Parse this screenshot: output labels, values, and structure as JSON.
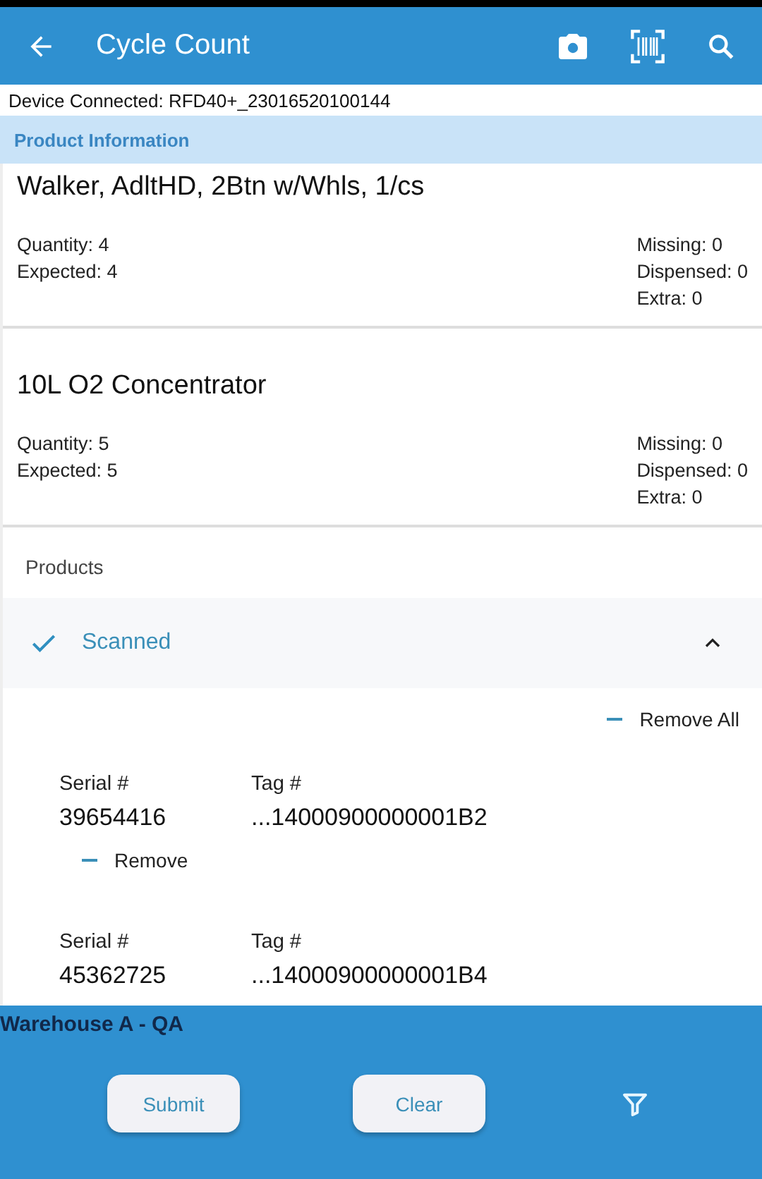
{
  "app_bar": {
    "title": "Cycle Count"
  },
  "device_status": "Device Connected: RFD40+_23016520100144",
  "section_header": "Product Information",
  "products": [
    {
      "name": "Walker, AdltHD, 2Btn w/Whls, 1/cs",
      "quantity": "Quantity: 4",
      "expected": "Expected: 4",
      "missing": "Missing: 0",
      "dispensed": "Dispensed: 0",
      "extra": "Extra: 0"
    },
    {
      "name": "10L O2 Concentrator",
      "quantity": "Quantity: 5",
      "expected": "Expected: 5",
      "missing": "Missing: 0",
      "dispensed": "Dispensed: 0",
      "extra": "Extra: 0"
    }
  ],
  "products_label": "Products",
  "scanned": {
    "title": "Scanned",
    "expanded": true,
    "remove_all": "Remove All",
    "items": [
      {
        "serial_label": "Serial #",
        "serial": "39654416",
        "tag_label": "Tag #",
        "tag": "...14000900000001B2",
        "remove": "Remove"
      },
      {
        "serial_label": "Serial #",
        "serial": "45362725",
        "tag_label": "Tag #",
        "tag": "...14000900000001B4"
      }
    ]
  },
  "footer": {
    "location": "Warehouse A - QA",
    "buttons": [
      "Submit",
      "Clear"
    ]
  }
}
